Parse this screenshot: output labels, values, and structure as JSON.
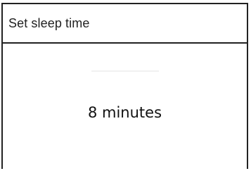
{
  "dialog": {
    "title": "Set sleep time",
    "value_text": "8 minutes"
  },
  "colors": {
    "border": "#222222",
    "text": "#111111",
    "background": "#ffffff"
  }
}
